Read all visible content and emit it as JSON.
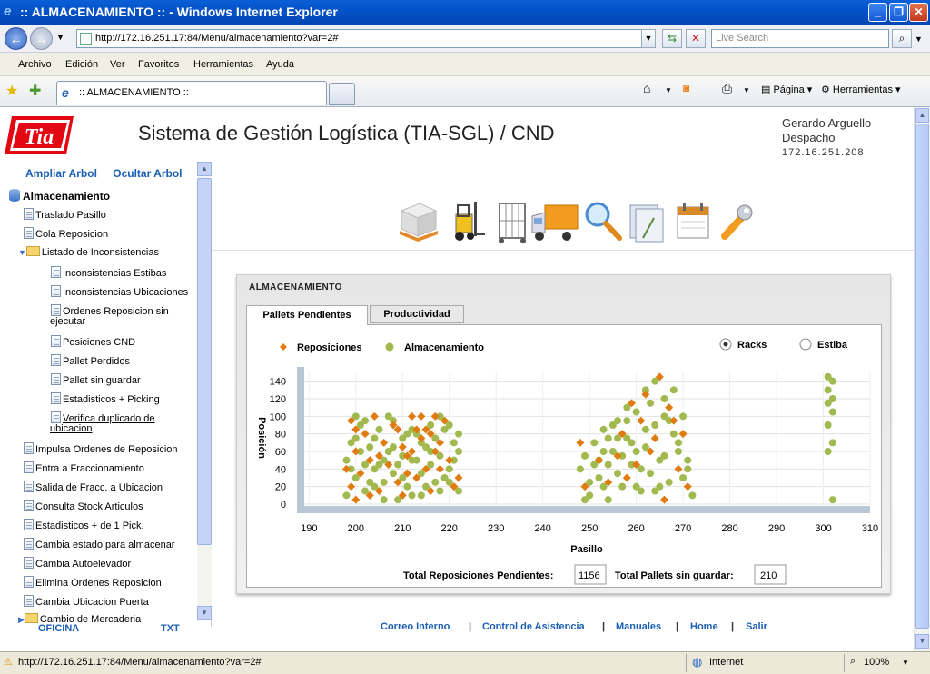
{
  "window": {
    "title": ":: ALMACENAMIENTO :: - Windows Internet Explorer",
    "address": "http://172.16.251.17:84/Menu/almacenamiento?var=2#",
    "search_placeholder": "Live Search"
  },
  "menu": [
    "Archivo",
    "Edición",
    "Ver",
    "Favoritos",
    "Herramientas",
    "Ayuda"
  ],
  "tab": {
    "label": ":: ALMACENAMIENTO ::"
  },
  "toolbar": {
    "page_label": "Página",
    "tools_label": "Herramientas"
  },
  "header": {
    "logo_text": "Tia",
    "title": "Sistema de Gestión Logística (TIA-SGL) / CND",
    "user_name": "Gerardo Arguello",
    "user_role": "Despacho",
    "user_ip": "172.16.251.208"
  },
  "sidebar": {
    "expand_label": "Ampliar Arbol",
    "hide_label": "Ocultar Arbol",
    "root": "Almacenamiento",
    "items_a": [
      "Traslado Pasillo",
      "Cola Reposicion"
    ],
    "folder": "Listado de Inconsistencias",
    "sub_items": [
      "Inconsistencias Estibas",
      "Inconsistencias Ubicaciones",
      "Ordenes Reposicion sin",
      "ejecutar",
      "Posiciones CND",
      "Pallet Perdidos",
      "Pallet sin guardar",
      "Estadisticos + Picking",
      "Verifica duplicado de",
      "ubicacion"
    ],
    "items_b": [
      "Impulsa Ordenes de Reposicion",
      "Entra a Fraccionamiento",
      "Salida de Fracc. a Ubicacion",
      "Consulta Stock Articulos",
      "Estadisticos + de 1 Pick.",
      "Cambia estado para almacenar",
      "Cambia Autoelevador",
      "Elimina Ordenes Reposicion",
      "Cambia Ubicacion Puerta",
      "Cambio de Mercaderia"
    ],
    "footer_left": "OFICINA",
    "footer_right": "TXT"
  },
  "panel": {
    "title": "ALMACENAMIENTO",
    "tab_active": "Pallets Pendientes",
    "tab_other": "Productividad",
    "radio_racks": "Racks",
    "radio_estiba": "Estiba",
    "total_repos_label": "Total Reposiciones Pendientes:",
    "total_repos_value": "1156",
    "total_pallets_label": "Total Pallets sin guardar:",
    "total_pallets_value": "210"
  },
  "footer_links": [
    "Correo Interno",
    "|",
    "Control de Asistencia",
    "|",
    "Manuales",
    "|",
    "Home",
    "|",
    "Salir"
  ],
  "status": {
    "url": "http://172.16.251.17:84/Menu/almacenamiento?var=2#",
    "zone": "Internet",
    "zoom": "100%"
  },
  "chart_data": {
    "type": "scatter",
    "xlabel": "Pasillo",
    "ylabel": "Posición",
    "xlim": [
      188,
      310
    ],
    "ylim": [
      0,
      150
    ],
    "xticks": [
      190,
      200,
      210,
      220,
      230,
      240,
      250,
      260,
      270,
      280,
      290,
      300,
      310
    ],
    "yticks": [
      0,
      20,
      40,
      60,
      80,
      100,
      120,
      140
    ],
    "colors": {
      "reposiciones": "#e07b10",
      "almacenamiento": "#a2b94f",
      "axisbar": "#b8c6d6"
    },
    "series": [
      {
        "name": "Reposiciones",
        "marker": "diamond",
        "points": [
          [
            199,
            95
          ],
          [
            200,
            60
          ],
          [
            201,
            35
          ],
          [
            202,
            80
          ],
          [
            203,
            50
          ],
          [
            204,
            100
          ],
          [
            205,
            15
          ],
          [
            206,
            70
          ],
          [
            198,
            40
          ],
          [
            199,
            20
          ],
          [
            200,
            85
          ],
          [
            207,
            45
          ],
          [
            208,
            90
          ],
          [
            209,
            25
          ],
          [
            210,
            65
          ],
          [
            211,
            55
          ],
          [
            212,
            100
          ],
          [
            213,
            30
          ],
          [
            214,
            75
          ],
          [
            215,
            85
          ],
          [
            216,
            15
          ],
          [
            217,
            60
          ],
          [
            218,
            40
          ],
          [
            219,
            95
          ],
          [
            220,
            50
          ],
          [
            221,
            20
          ],
          [
            214,
            100
          ],
          [
            212,
            60
          ],
          [
            216,
            80
          ],
          [
            218,
            70
          ],
          [
            209,
            85
          ],
          [
            211,
            35
          ],
          [
            203,
            10
          ],
          [
            205,
            55
          ],
          [
            200,
            5
          ],
          [
            222,
            30
          ],
          [
            215,
            40
          ],
          [
            217,
            100
          ],
          [
            213,
            85
          ],
          [
            210,
            10
          ],
          [
            248,
            70
          ],
          [
            249,
            20
          ],
          [
            256,
            55
          ],
          [
            258,
            30
          ],
          [
            261,
            95
          ],
          [
            263,
            60
          ],
          [
            265,
            145
          ],
          [
            267,
            110
          ],
          [
            269,
            40
          ],
          [
            270,
            80
          ],
          [
            271,
            20
          ],
          [
            262,
            125
          ],
          [
            264,
            75
          ],
          [
            266,
            5
          ],
          [
            268,
            95
          ],
          [
            252,
            50
          ],
          [
            254,
            25
          ],
          [
            259,
            115
          ],
          [
            260,
            45
          ],
          [
            257,
            80
          ]
        ]
      },
      {
        "name": "Almacenamiento",
        "marker": "circle",
        "points": [
          [
            198,
            50
          ],
          [
            199,
            70
          ],
          [
            200,
            30
          ],
          [
            201,
            90
          ],
          [
            202,
            15
          ],
          [
            203,
            65
          ],
          [
            204,
            40
          ],
          [
            205,
            85
          ],
          [
            206,
            25
          ],
          [
            207,
            60
          ],
          [
            208,
            95
          ],
          [
            209,
            45
          ],
          [
            210,
            75
          ],
          [
            211,
            20
          ],
          [
            212,
            50
          ],
          [
            213,
            80
          ],
          [
            214,
            35
          ],
          [
            215,
            65
          ],
          [
            216,
            90
          ],
          [
            217,
            25
          ],
          [
            218,
            55
          ],
          [
            219,
            85
          ],
          [
            220,
            40
          ],
          [
            221,
            70
          ],
          [
            222,
            15
          ],
          [
            198,
            10
          ],
          [
            200,
            100
          ],
          [
            202,
            45
          ],
          [
            204,
            75
          ],
          [
            206,
            5
          ],
          [
            208,
            35
          ],
          [
            210,
            55
          ],
          [
            212,
            10
          ],
          [
            214,
            70
          ],
          [
            216,
            45
          ],
          [
            218,
            15
          ],
          [
            220,
            90
          ],
          [
            222,
            60
          ],
          [
            199,
            40
          ],
          [
            201,
            60
          ],
          [
            203,
            25
          ],
          [
            205,
            45
          ],
          [
            207,
            100
          ],
          [
            209,
            5
          ],
          [
            211,
            80
          ],
          [
            213,
            50
          ],
          [
            215,
            20
          ],
          [
            217,
            75
          ],
          [
            219,
            30
          ],
          [
            221,
            50
          ],
          [
            200,
            75
          ],
          [
            202,
            95
          ],
          [
            204,
            20
          ],
          [
            206,
            50
          ],
          [
            208,
            65
          ],
          [
            210,
            30
          ],
          [
            212,
            85
          ],
          [
            214,
            10
          ],
          [
            216,
            60
          ],
          [
            218,
            100
          ],
          [
            220,
            25
          ],
          [
            222,
            80
          ],
          [
            248,
            40
          ],
          [
            249,
            55
          ],
          [
            250,
            10
          ],
          [
            251,
            70
          ],
          [
            252,
            30
          ],
          [
            253,
            85
          ],
          [
            254,
            5
          ],
          [
            255,
            60
          ],
          [
            256,
            95
          ],
          [
            257,
            20
          ],
          [
            258,
            75
          ],
          [
            259,
            45
          ],
          [
            260,
            105
          ],
          [
            261,
            15
          ],
          [
            262,
            65
          ],
          [
            263,
            35
          ],
          [
            264,
            90
          ],
          [
            265,
            50
          ],
          [
            266,
            120
          ],
          [
            267,
            25
          ],
          [
            268,
            80
          ],
          [
            269,
            60
          ],
          [
            270,
            100
          ],
          [
            271,
            40
          ],
          [
            272,
            10
          ],
          [
            250,
            25
          ],
          [
            252,
            50
          ],
          [
            254,
            75
          ],
          [
            256,
            35
          ],
          [
            258,
            110
          ],
          [
            260,
            60
          ],
          [
            262,
            85
          ],
          [
            264,
            15
          ],
          [
            266,
            55
          ],
          [
            268,
            130
          ],
          [
            270,
            30
          ],
          [
            249,
            5
          ],
          [
            251,
            45
          ],
          [
            253,
            20
          ],
          [
            255,
            90
          ],
          [
            257,
            55
          ],
          [
            259,
            70
          ],
          [
            261,
            40
          ],
          [
            263,
            115
          ],
          [
            265,
            20
          ],
          [
            267,
            95
          ],
          [
            269,
            70
          ],
          [
            271,
            50
          ],
          [
            258,
            95
          ],
          [
            262,
            130
          ],
          [
            264,
            140
          ],
          [
            266,
            100
          ],
          [
            260,
            20
          ],
          [
            256,
            75
          ],
          [
            254,
            45
          ],
          [
            253,
            60
          ],
          [
            301,
            145
          ],
          [
            301,
            130
          ],
          [
            302,
            120
          ],
          [
            302,
            105
          ],
          [
            301,
            90
          ],
          [
            302,
            70
          ],
          [
            301,
            60
          ],
          [
            302,
            5
          ],
          [
            302,
            140
          ],
          [
            301,
            115
          ]
        ]
      }
    ]
  }
}
